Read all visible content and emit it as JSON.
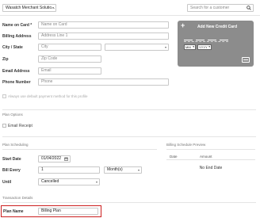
{
  "header": {
    "merchant_select": "Wasatch Merchant Solutio...",
    "customer_search_placeholder": "Search for a customer"
  },
  "card_form": {
    "name_on_card_label": "Name on Card *",
    "name_on_card_placeholder": "Name on Card",
    "billing_address_label": "Billing Address",
    "billing_address_placeholder": "Address Line 1",
    "city_state_label": "City / State",
    "city_placeholder": "City",
    "state_value": "",
    "zip_label": "Zip",
    "zip_placeholder": "Zip Code",
    "email_label": "Email Address",
    "email_placeholder": "Email",
    "phone_label": "Phone Number",
    "phone_placeholder": "Phone",
    "default_payment_text": "Always use default payment method for this profile"
  },
  "credit_card": {
    "title": "Add New Credit Card",
    "plus": "+",
    "month_placeholder": "MM",
    "year_placeholder": "YYYY",
    "card_bg": "#8c8c8c"
  },
  "plan_options": {
    "section_label": "Plan Options",
    "email_receipt_label": "Email Receipt"
  },
  "plan_scheduling": {
    "section_label": "Plan Scheduling",
    "start_date_label": "Start Date",
    "start_date_value": "01/04/2022",
    "bill_every_label": "Bill Every",
    "bill_every_value": "1",
    "bill_every_unit": "Month(s)",
    "until_label": "Until",
    "until_value": "Cancelled"
  },
  "billing_preview": {
    "section_label": "Billing Schedule Preview",
    "col_date": "Date",
    "col_amount": "Amount",
    "empty_text": "No End Date"
  },
  "transaction_details": {
    "section_label": "Transaction Details",
    "plan_name_label": "Plan Name",
    "plan_name_value": "Billing Plan",
    "highlight_color": "#cc1f1f"
  }
}
